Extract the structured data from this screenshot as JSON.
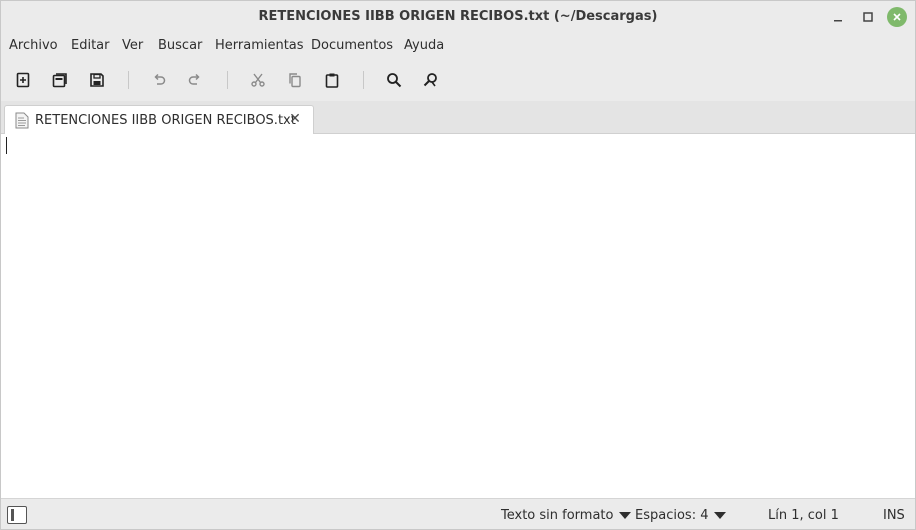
{
  "window": {
    "title": "RETENCIONES IIBB ORIGEN RECIBOS.txt (~/Descargas)",
    "controls": [
      "minimize-icon",
      "maximize-icon",
      "close-icon"
    ],
    "close_color": "#7fb96b"
  },
  "menubar": {
    "items": [
      "Archivo",
      "Editar",
      "Ver",
      "Buscar",
      "Herramientas",
      "Documentos",
      "Ayuda"
    ]
  },
  "toolbar": {
    "buttons": [
      "new-document-icon",
      "open-document-icon",
      "save-icon",
      "undo-icon",
      "redo-icon",
      "cut-icon",
      "copy-icon",
      "paste-icon",
      "search-icon",
      "replace-icon"
    ]
  },
  "tabs": [
    {
      "label": "RETENCIONES IIBB ORIGEN RECIBOS.txt",
      "icon": "text-file-icon",
      "close_icon": "close-tab-icon"
    }
  ],
  "editor": {
    "content": ""
  },
  "statusbar": {
    "syntax": "Texto sin formato",
    "indent": "Espacios: 4",
    "position": "Lín 1, col 1",
    "mode": "INS"
  }
}
